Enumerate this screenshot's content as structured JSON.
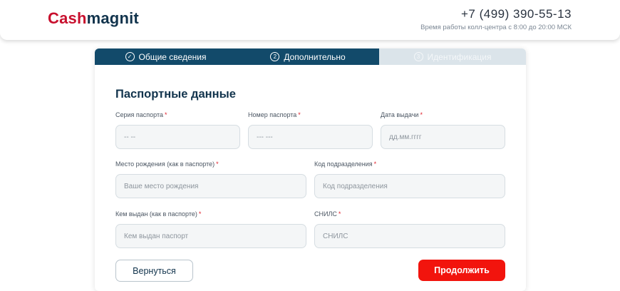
{
  "header": {
    "logo_part1": "Cash",
    "logo_part2": "magnit",
    "phone": "+7 (499) 390-55-13",
    "hours": "Время работы колл-центра с 8:00 до 20:00 МСК"
  },
  "steps": [
    {
      "label": "Общие сведения",
      "icon": "✓",
      "state": "done"
    },
    {
      "label": "Дополнительно",
      "icon": "2",
      "state": "active"
    },
    {
      "label": "Идентификация",
      "icon": "3",
      "state": "pending"
    }
  ],
  "form": {
    "title": "Паспортные данные",
    "required_mark": "*",
    "fields": {
      "series": {
        "label": "Серия паспорта",
        "placeholder": "-- --"
      },
      "number": {
        "label": "Номер паспорта",
        "placeholder": "--- ---"
      },
      "issue_date": {
        "label": "Дата выдачи",
        "placeholder": "дд.мм.гггг"
      },
      "birthplace": {
        "label": "Место рождения (как в паспорте)",
        "placeholder": "Ваше место рождения"
      },
      "division_code": {
        "label": "Код подразделения",
        "placeholder": "Код подразделения"
      },
      "issued_by": {
        "label": "Кем выдан (как в паспорте)",
        "placeholder": "Кем выдан паспорт"
      },
      "snils": {
        "label": "СНИЛС",
        "placeholder": "СНИЛС"
      }
    }
  },
  "buttons": {
    "back": "Вернуться",
    "next": "Продолжить"
  },
  "colors": {
    "brand_red": "#c8102e",
    "brand_blue": "#12344d",
    "step_active": "#124a6a",
    "step_pending": "#dbe4ea",
    "cta": "#f2140d"
  }
}
